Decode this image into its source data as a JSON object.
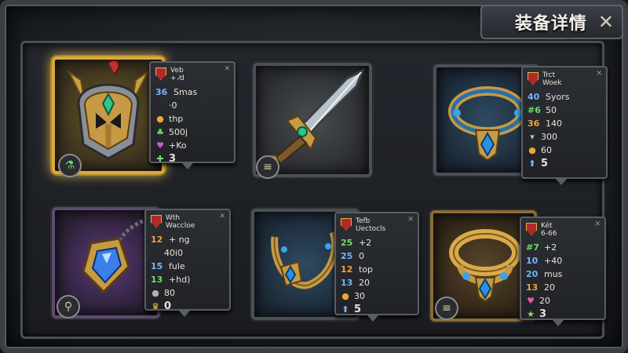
{
  "title": "装备详情",
  "close_glyph": "✕",
  "colors": {
    "gold": "#f0c655",
    "blue_num": "#6fb8ff",
    "green_num": "#6edb6a",
    "orange_num": "#f0a43a"
  },
  "items": [
    {
      "name": "helmet",
      "badge": "⚗",
      "header": [
        "Veb",
        "+ ⁄d"
      ],
      "stats": [
        {
          "num": "36",
          "text": "Smas",
          "icon": "",
          "color": "#6fb8ff"
        },
        {
          "num": "",
          "text": "·0",
          "icon": "",
          "color": ""
        },
        {
          "num": "",
          "text": "thp",
          "icon": "●",
          "color": "#f0a43a"
        },
        {
          "num": "",
          "text": "500j",
          "icon": "♣",
          "color": "#6edb6a"
        },
        {
          "num": "",
          "text": "+Ko",
          "icon": "♥",
          "color": "#c45cd6"
        },
        {
          "num": "",
          "text": "3",
          "icon": "✚",
          "color": "#6edb6a"
        }
      ]
    },
    {
      "name": "sword",
      "badge": "≡",
      "header": [],
      "stats": []
    },
    {
      "name": "collar",
      "badge": "",
      "header": [
        "Trct",
        "Woek"
      ],
      "stats": [
        {
          "num": "40",
          "text": "Syors",
          "icon": "",
          "color": "#6fb8ff"
        },
        {
          "num": "#6",
          "text": "50",
          "icon": "",
          "color": "#6edb6a"
        },
        {
          "num": "36",
          "text": "140",
          "icon": "",
          "color": "#f0a43a"
        },
        {
          "num": "",
          "text": "300",
          "icon": "▾",
          "color": "#9fc7e8"
        },
        {
          "num": "",
          "text": "60",
          "icon": "●",
          "color": "#f0a43a"
        },
        {
          "num": "",
          "text": "5",
          "icon": "⬆",
          "color": "#6fb8ff"
        }
      ]
    },
    {
      "name": "amulet",
      "badge": "⚲",
      "header": [
        "Wth",
        "Waccloe"
      ],
      "stats": [
        {
          "num": "12",
          "text": "+ ng",
          "icon": "",
          "color": "#f0a43a"
        },
        {
          "num": "",
          "text": "40i0",
          "icon": "",
          "color": ""
        },
        {
          "num": "15",
          "text": "fule",
          "icon": "",
          "color": "#6fb8ff"
        },
        {
          "num": "13",
          "text": "+hd)",
          "icon": "",
          "color": "#6edb6a"
        },
        {
          "num": "",
          "text": "80",
          "icon": "●",
          "color": "#b0b0b0"
        },
        {
          "num": "",
          "text": "0",
          "icon": "♛",
          "color": "#f0c655"
        }
      ]
    },
    {
      "name": "blue-necklace",
      "badge": "",
      "header": [
        "Tefb",
        "Uectocls"
      ],
      "stats": [
        {
          "num": "25",
          "text": "+2",
          "icon": "",
          "color": "#6edb6a"
        },
        {
          "num": "25",
          "text": "0",
          "icon": "",
          "color": "#6fb8ff"
        },
        {
          "num": "12",
          "text": "top",
          "icon": "",
          "color": "#f0a43a"
        },
        {
          "num": "13",
          "text": "20",
          "icon": "",
          "color": "#6fb8ff"
        },
        {
          "num": "",
          "text": "30",
          "icon": "●",
          "color": "#f0a43a"
        },
        {
          "num": "",
          "text": "5",
          "icon": "⬆",
          "color": "#6fb8ff"
        }
      ]
    },
    {
      "name": "gold-necklace",
      "badge": "≡",
      "header": [
        "Két",
        "6-66"
      ],
      "stats": [
        {
          "num": "#7",
          "text": "+2",
          "icon": "",
          "color": "#6edb6a"
        },
        {
          "num": "10",
          "text": "+40",
          "icon": "",
          "color": "#6fb8ff"
        },
        {
          "num": "20",
          "text": "mus",
          "icon": "",
          "color": "#6fb8ff"
        },
        {
          "num": "13",
          "text": "20",
          "icon": "",
          "color": "#f0a43a"
        },
        {
          "num": "",
          "text": "20",
          "icon": "♥",
          "color": "#e05c9a"
        },
        {
          "num": "",
          "text": "3",
          "icon": "★",
          "color": "#8be05c"
        }
      ]
    }
  ]
}
